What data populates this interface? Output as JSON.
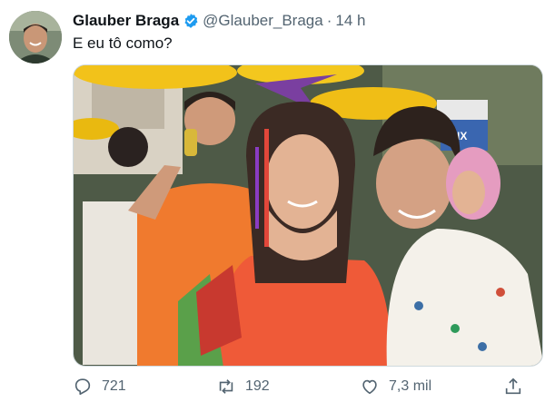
{
  "tweet": {
    "author_name": "Glauber Braga",
    "handle": "@Glauber_Braga",
    "separator": "·",
    "timestamp": "14 h",
    "text": "E eu tô como?"
  },
  "media": {
    "sign_text": "KNX"
  },
  "actions": {
    "replies": "721",
    "retweets": "192",
    "likes": "7,3 mil"
  },
  "icons": {
    "verified": "verified-badge-icon",
    "reply": "reply-icon",
    "retweet": "retweet-icon",
    "like": "heart-icon",
    "share": "share-icon"
  },
  "colors": {
    "verified_blue": "#1d9bf0",
    "text_secondary": "#536471"
  }
}
